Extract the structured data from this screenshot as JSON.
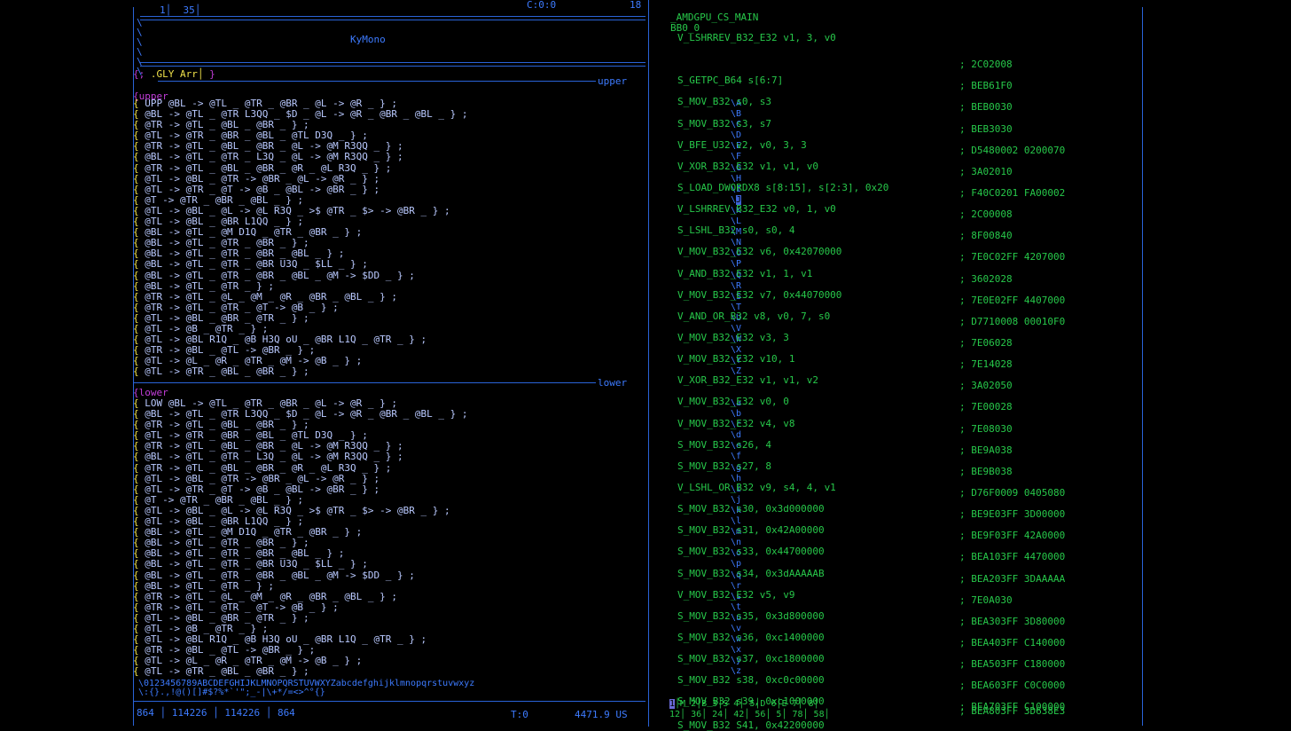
{
  "left": {
    "gutter": "1│  35│",
    "cursor_pos": "C:0:0",
    "pos_right": "18",
    "font_name": "KyMono",
    "command": ".GLY Arr│",
    "cmd_prefix": "{;",
    "cmd_suffix": "}",
    "upper_label": "upper",
    "upper_tag": "{upper",
    "lower_label": "lower",
    "lower_tag": "{lower",
    "upper_rows": [
      "UPP @BL -> @TL _ @TR _ @BR _ @L -> @R _ } ;",
      "@BL -> @TL _ @TR L3QQ _ $D _ @L -> @R _ @BR _ @BL _ } ;",
      "@TR -> @TL _ @BL _ @BR _ } ;",
      "@TL -> @TR _ @BR _ @BL _ @TL D3Q _ } ;",
      "@TR -> @TL _ @BL _ @BR _ @L -> @M R3QQ _ } ;",
      "@BL -> @TL _ @TR _ L3Q _ @L -> @M R3QQ _ } ;",
      "@TR -> @TL _ @BL _ @BR _ @R _ @L R3Q _ } ;",
      "@TL -> @BL _ @TR -> @BR _ @L -> @R _ } ;",
      "@TL -> @TR _ @T -> @B _ @BL -> @BR _ } ;",
      "@T -> @TR _ @BR _ @BL _ } ;",
      "@TL -> @BL _ @L -> @L R3Q _ >$ @TR _ $> -> @BR _ } ;",
      "@TL -> @BL _ @BR L1QQ _ } ;",
      "@BL -> @TL _ @M D1Q _ @TR _ @BR _ } ;",
      "@BL -> @TL _ @TR _ @BR _ } ;",
      "@BL -> @TL _ @TR _ @BR _ @BL _ } ;",
      "@BL -> @TL _ @TR _ @BR U3Q _ $LL _ } ;",
      "@BL -> @TL _ @TR _ @BR _ @BL _ @M -> $DD _ } ;",
      "@BL -> @TL _ @TR _ } ;",
      "@TR -> @TL _ @L _ @M _ @R _ @BR _ @BL _ } ;",
      "@TR -> @TL _ @TR _ @T -> @B _ } ;",
      "@TL -> @BL _ @BR _ @TR _ } ;",
      "@TL -> @B _ @TR _ } ;",
      "@TL -> @BL R1Q _ @B H3Q oU _ @BR L1Q _ @TR _ } ;",
      "@TR -> @BL _ @TL -> @BR _ } ;",
      "@TL -> @L _ @R _ @TR _ @M -> @B _ } ;",
      "@TL -> @TR _ @BL _ @BR _ } ;"
    ],
    "lower_rows": [
      "LOW @BL -> @TL _ @TR _ @BR _ @L -> @R _ } ;",
      "@BL -> @TL _ @TR L3QQ _ $D _ @L -> @R _ @BR _ @BL _ } ;",
      "@TR -> @TL _ @BL _ @BR _ } ;",
      "@TL -> @TR _ @BR _ @BL _ @TL D3Q _ } ;",
      "@TR -> @TL _ @BL _ @BR _ @L -> @M R3QQ _ } ;",
      "@BL -> @TL _ @TR _ L3Q _ @L -> @M R3QQ _ } ;",
      "@TR -> @TL _ @BL _ @BR _ @R _ @L R3Q _ } ;",
      "@TL -> @BL _ @TR -> @BR _ @L -> @R _ } ;",
      "@TL -> @TR _ @T -> @B _ @BL -> @BR _ } ;",
      "@T -> @TR _ @BR _ @BL _ } ;",
      "@TL -> @BL _ @L -> @L R3Q _ >$ @TR _ $> -> @BR _ } ;",
      "@TL -> @BL _ @BR L1QQ _ } ;",
      "@BL -> @TL _ @M D1Q _ @TR _ @BR _ } ;",
      "@BL -> @TL _ @TR _ @BR _ } ;",
      "@BL -> @TL _ @TR _ @BR _ @BL _ } ;",
      "@BL -> @TL _ @TR _ @BR U3Q _ $LL _ } ;",
      "@BL -> @TL _ @TR _ @BR _ @BL _ @M -> $DD _ } ;",
      "@BL -> @TL _ @TR _ } ;",
      "@TR -> @TL _ @L _ @M _ @R _ @BR _ @BL _ } ;",
      "@TR -> @TL _ @TR _ @T -> @B _ } ;",
      "@TL -> @BL _ @BR _ @TR _ } ;",
      "@TL -> @B _ @TR _ } ;",
      "@TL -> @BL R1Q _ @B H3Q oU _ @BR L1Q _ @TR _ } ;",
      "@TR -> @BL _ @TL -> @BR _ } ;",
      "@TL -> @L _ @R _ @TR _ @M -> @B _ } ;",
      "@TL -> @TR _ @BL _ @BR _ } ;"
    ],
    "upper_letters": [
      "A",
      "B",
      "C",
      "D",
      "E",
      "F",
      "G",
      "H",
      "I",
      "J",
      "K",
      "L",
      "M",
      "N",
      "O",
      "P",
      "Q",
      "R",
      "S",
      "T",
      "U",
      "V",
      "W",
      "X",
      "Y",
      "Z"
    ],
    "lower_letters": [
      "a",
      "b",
      "c",
      "d",
      "e",
      "f",
      "g",
      "h",
      "i",
      "j",
      "k",
      "l",
      "m",
      "n",
      "o",
      "p",
      "q",
      "r",
      "s",
      "t",
      "u",
      "v",
      "w",
      "x",
      "y",
      "z"
    ],
    "charset_line1": "\\0123456789ABCDEFGHIJKLMNOPQRSTUVWXYZabcdefghijklmnopqrstuvwxyz",
    "charset_line2": "\\:{}.,!@()[]#$?%*`'\";_-|\\+*/=<>^°{}",
    "status": "864 │ 114226 │ 114226 │ 864",
    "status_t": "T:0",
    "status_right": "4471.9 US"
  },
  "right": {
    "header1": "_AMDGPU_CS_MAIN",
    "header2": "BB0_0",
    "instructions": [
      {
        "op": "V_LSHRREV_B32_E32 v1, 3, v0",
        "enc": ""
      },
      {
        "op": "",
        "enc": "; 2C02008"
      },
      {
        "op": "S_GETPC_B64 s[6:7]",
        "enc": "; BEB61F0"
      },
      {
        "op": "S_MOV_B32 s0, s3",
        "enc": "; BEB0030"
      },
      {
        "op": "S_MOV_B32 s3, s7",
        "enc": "; BEB3030"
      },
      {
        "op": "V_BFE_U32 v2, v0, 3, 3",
        "enc": "; D5480002 0200070"
      },
      {
        "op": "V_XOR_B32_E32 v1, v1, v0",
        "enc": "; 3A02010"
      },
      {
        "op": "S_LOAD_DWORDX8 s[8:15], s[2:3], 0x20",
        "enc": "; F40C0201 FA00002"
      },
      {
        "op": "V_LSHRREV_B32_E32 v0, 1, v0",
        "enc": "; 2C00008"
      },
      {
        "op": "S_LSHL_B32 s0, s0, 4",
        "enc": "; 8F00840"
      },
      {
        "op": "V_MOV_B32_E32 v6, 0x42070000",
        "enc": "; 7E0C02FF 4207000"
      },
      {
        "op": "V_AND_B32_E32 v1, 1, v1",
        "enc": "; 3602028"
      },
      {
        "op": "V_MOV_B32_E32 v7, 0x44070000",
        "enc": "; 7E0E02FF 4407000"
      },
      {
        "op": "V_AND_OR_B32 v8, v0, 7, s0",
        "enc": "; D7710008 00010F0"
      },
      {
        "op": "V_MOV_B32_E32 v3, 3",
        "enc": "; 7E06028"
      },
      {
        "op": "V_MOV_B32_E32 v10, 1",
        "enc": "; 7E14028"
      },
      {
        "op": "V_XOR_B32_E32 v1, v1, v2",
        "enc": "; 3A02050"
      },
      {
        "op": "V_MOV_B32_E32 v0, 0",
        "enc": "; 7E00028"
      },
      {
        "op": "V_MOV_B32_E32 v4, v8",
        "enc": "; 7E08030"
      },
      {
        "op": "S_MOV_B32 s26, 4",
        "enc": "; BE9A038"
      },
      {
        "op": "S_MOV_B32 s27, 8",
        "enc": "; BE9B038"
      },
      {
        "op": "V_LSHL_OR_B32 v9, s4, 4, v1",
        "enc": "; D76F0009 0405080"
      },
      {
        "op": "S_MOV_B32 s30, 0x3d000000",
        "enc": "; BE9E03FF 3D00000"
      },
      {
        "op": "S_MOV_B32 s31, 0x42A00000",
        "enc": "; BE9F03FF 42A0000"
      },
      {
        "op": "S_MOV_B32 s33, 0x44700000",
        "enc": "; BEA103FF 4470000"
      },
      {
        "op": "S_MOV_B32 s34, 0x3dAAAAAB",
        "enc": "; BEA203FF 3DAAAAA"
      },
      {
        "op": "V_MOV_B32_E32 v5, v9",
        "enc": "; 7E0A030"
      },
      {
        "op": "S_MOV_B32 s35, 0x3d800000",
        "enc": "; BEA303FF 3D80000"
      },
      {
        "op": "S_MOV_B32 s36, 0xc1400000",
        "enc": "; BEA403FF C140000"
      },
      {
        "op": "S_MOV_B32 s37, 0xc1800000",
        "enc": "; BEA503FF C180000"
      },
      {
        "op": "S_MOV_B32 s38, 0xc0c00000",
        "enc": "; BEA603FF C0C0000"
      },
      {
        "op": "S_MOV_B32 s39, 0xc1000000",
        "enc": "; BEA703FF C100000"
      }
    ],
    "ruler_top": "1│M 2│B 3│S 4│  5│D 6│E 7│  8│",
    "ruler_bottom": "12│ 36│ 24│ 42│ 56│  5│ 78│ 58│",
    "ruler_enc": "; BEA803FF 3D638E3",
    "partial_line": "S_MOV_B32 S41, 0x42200000"
  }
}
